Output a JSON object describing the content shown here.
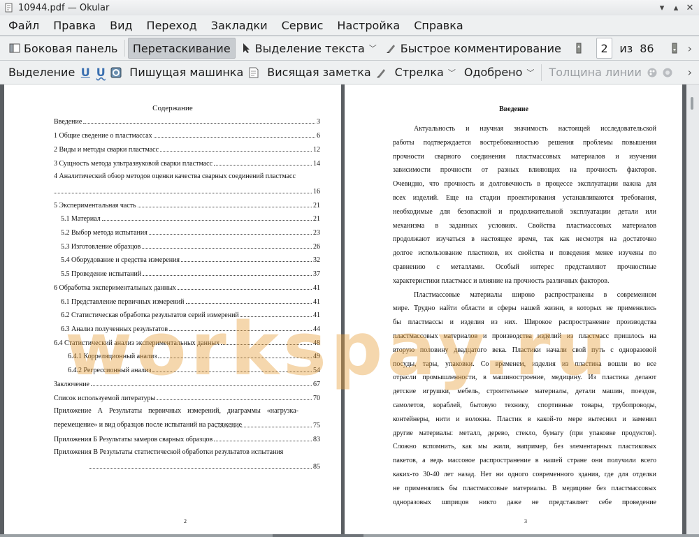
{
  "window": {
    "title": "10944.pdf — Okular"
  },
  "menu": [
    "Файл",
    "Правка",
    "Вид",
    "Переход",
    "Закладки",
    "Сервис",
    "Настройка",
    "Справка"
  ],
  "toolbar1": {
    "sidebar": "Боковая панель",
    "drag": "Перетаскивание",
    "text_select": "Выделение текста",
    "quick_annot": "Быстрое комментирование",
    "page_current": "2",
    "page_of": "из",
    "page_total": "86"
  },
  "toolbar2": {
    "select": "Выделение",
    "typewriter": "Пишущая машинка",
    "note": "Висящая заметка",
    "arrow": "Стрелка",
    "approved": "Одобрено",
    "line_width": "Толщина линии"
  },
  "left_page": {
    "title": "Содержание",
    "page_number": "2",
    "toc": [
      {
        "label": "Введение",
        "page": "3"
      },
      {
        "label": "1 Общие сведение о пластмассах",
        "page": "6"
      },
      {
        "label": "2 Виды и методы сварки пластмасс",
        "page": "12"
      },
      {
        "label": "3 Сущность метода ультразвуковой сварки пластмасс",
        "page": "14"
      },
      {
        "label": "4 Аналитический обзор методов оценки качества сварных соединений пластмасс",
        "page": "16"
      },
      {
        "label": "5 Экспериментальная часть",
        "page": "21"
      },
      {
        "label": "5.1 Материал",
        "page": "21"
      },
      {
        "label": "5.2 Выбор метода испытания",
        "page": "23"
      },
      {
        "label": "5.3 Изготовление образцов",
        "page": "26"
      },
      {
        "label": "5.4 Оборудование и средства измерения",
        "page": "32"
      },
      {
        "label": "5.5 Проведение испытаний",
        "page": "37"
      },
      {
        "label": "6 Обработка экспериментальных данных",
        "page": "41"
      },
      {
        "label": "6.1 Представление первичных измерений",
        "page": "41"
      },
      {
        "label": "6.2 Статистическая обработка результатов серий измерений",
        "page": "41"
      },
      {
        "label": "6.3 Анализ полученных результатов",
        "page": "44"
      },
      {
        "label": "6.4 Статистический анализ экспериментальных данных",
        "page": "48"
      },
      {
        "label": "6.4.1 Корреляционный анализ",
        "page": "49"
      },
      {
        "label": "6.4.2 Регрессионный анализ",
        "page": "54"
      },
      {
        "label": "Заключение",
        "page": "67"
      },
      {
        "label": "Список используемой литературы",
        "page": "70"
      },
      {
        "label": "Приложение А Результаты первичных измерений, диаграммы «нагрузка-перемещение» и вид образцов после испытаний на растяжение",
        "page": "75"
      },
      {
        "label": "Приложения Б Результаты замеров сварных образцов",
        "page": "83"
      },
      {
        "label": "Приложения В Результаты статистической обработки результатов испытания",
        "page": "85"
      }
    ]
  },
  "right_page": {
    "title": "Введение",
    "page_number": "3",
    "lines": [
      "Актуальность и научная значимость настоящей исследовательской",
      "работы подтверждается востребованностью решения проблемы повышения",
      "прочности сварного соединения пластмассовых материалов и изучения",
      "зависимости прочности от разных влияющих на прочность факторов.",
      "Очевидно, что прочность и долговечность в процессе эксплуатации важна для",
      "всех изделий. Еще на стадии проектирования устанавливаются требования,",
      "необходимые для безопасной и продолжительной эксплуатации детали или",
      "механизма в заданных условиях. Свойства пластмассовых материалов",
      "продолжают изучаться в настоящее время, так как несмотря на достаточно",
      "долгое использование пластиков, их свойства и поведения менее изучены по",
      "сравнению с металлами. Особый интерес представляют прочностные",
      "характеристики пластмасс и влияние на прочность различных факторов.",
      "Пластмассовые материалы широко распространены в современном",
      "мире. Трудно найти области и сферы нашей жизни, в которых не применялись",
      "бы пластмассы и изделия из них. Широкое распространение производства",
      "пластмассовых материалов и производства изделий из пластмасс пришлось на",
      "вторую половину двадцатого века. Пластики начали свой путь с одноразовой",
      "посуды, тары, упаковки. Со временем, изделия из пластика вошли во все",
      "отрасли промышленности, в машиностроение, медицину. Из пластика делают",
      "детские игрушки, мебель, строительные материалы, детали машин, поездов,",
      "самолетов, кораблей, бытовую технику, спортивные товары, трубопроводы,",
      "контейнеры, нити и волокна. Пластик в какой-то мере вытеснил и заменил",
      "другие материалы: металл, дерево, стекло, бумагу (при упаковке продуктов).",
      "Сложно вспомнить, как мы жили, например, без элементарных пластиковых",
      "пакетов, а ведь массовое распространение в нашей стране они получили всего",
      "каких-то 30-40 лет назад. Нет ни одного современного здания, где для отделки",
      "не применялись бы пластмассовые материалы. В медицине без пластмассовых",
      "одноразовых шприцов никто даже не представляет себе проведение"
    ]
  },
  "watermark": "workspay.ru"
}
